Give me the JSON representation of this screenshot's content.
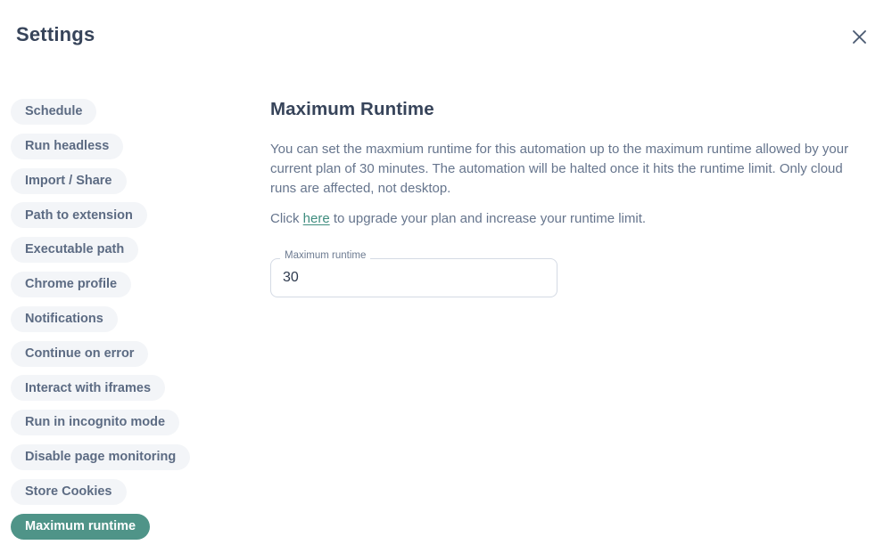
{
  "header": {
    "title": "Settings",
    "close_icon": "close-icon"
  },
  "theme": {
    "accent": "#4f9488",
    "link": "#3e8c7e",
    "pill_bg": "#f3f5f8",
    "pill_text": "#5c6b83",
    "heading_text": "#37445a",
    "body_text": "#66758d",
    "field_border": "#d4dae4",
    "page_bg": "#ffffff"
  },
  "sidebar": {
    "items": [
      {
        "label": "Schedule",
        "active": false
      },
      {
        "label": "Run headless",
        "active": false
      },
      {
        "label": "Import / Share",
        "active": false
      },
      {
        "label": "Path to extension",
        "active": false
      },
      {
        "label": "Executable path",
        "active": false
      },
      {
        "label": "Chrome profile",
        "active": false
      },
      {
        "label": "Notifications",
        "active": false
      },
      {
        "label": "Continue on error",
        "active": false
      },
      {
        "label": "Interact with iframes",
        "active": false
      },
      {
        "label": "Run in incognito mode",
        "active": false
      },
      {
        "label": "Disable page monitoring",
        "active": false
      },
      {
        "label": "Store Cookies",
        "active": false
      },
      {
        "label": "Maximum runtime",
        "active": true
      }
    ]
  },
  "main": {
    "section_title": "Maximum Runtime",
    "paragraph_1": "You can set the maxmium runtime for this automation up to the maximum runtime allowed by your current plan of 30 minutes. The automation will be halted once it hits the runtime limit. Only cloud runs are affected, not desktop.",
    "upgrade_prefix": "Click ",
    "upgrade_link": "here",
    "upgrade_suffix": " to upgrade your plan and increase your runtime limit.",
    "field": {
      "label": "Maximum runtime",
      "value": "30",
      "placeholder": "30"
    }
  }
}
